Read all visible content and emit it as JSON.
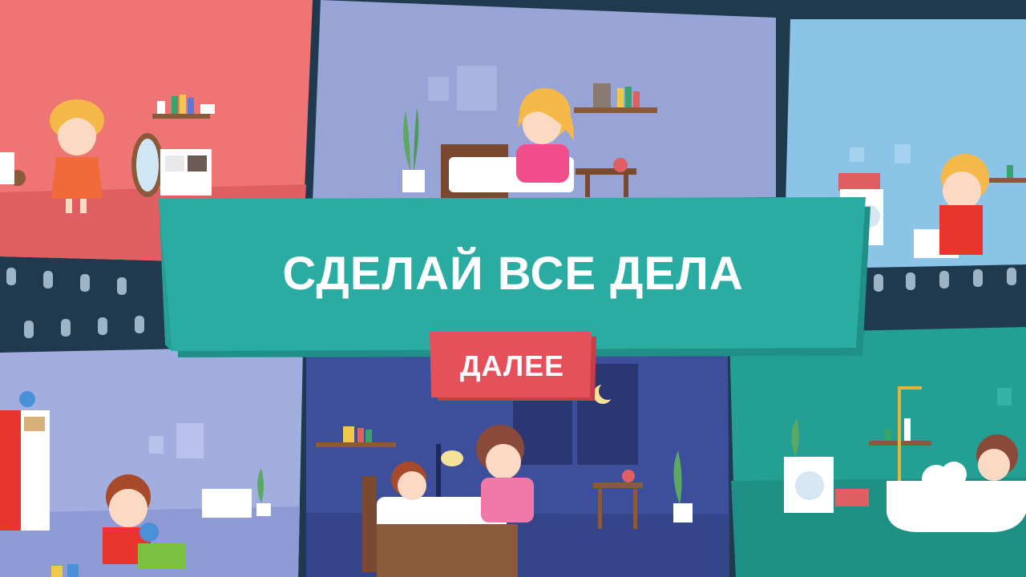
{
  "title": "СДЕЛАЙ ВСЕ ДЕЛА",
  "next_button": "ДАЛЕЕ",
  "colors": {
    "teal_banner": "#2aaca3",
    "red_button": "#e6505a",
    "film_strip": "#1f3a4f"
  },
  "scenes": [
    {
      "name": "brush-hair",
      "bg": "#ef7474"
    },
    {
      "name": "make-bed",
      "bg": "#98a4d6"
    },
    {
      "name": "brush-teeth",
      "bg": "#8cc4e8"
    },
    {
      "name": "tidy-toys",
      "bg": "#a2aee0"
    },
    {
      "name": "bedtime-story",
      "bg": "#3d4f9b"
    },
    {
      "name": "bath-time",
      "bg": "#23a093"
    }
  ]
}
